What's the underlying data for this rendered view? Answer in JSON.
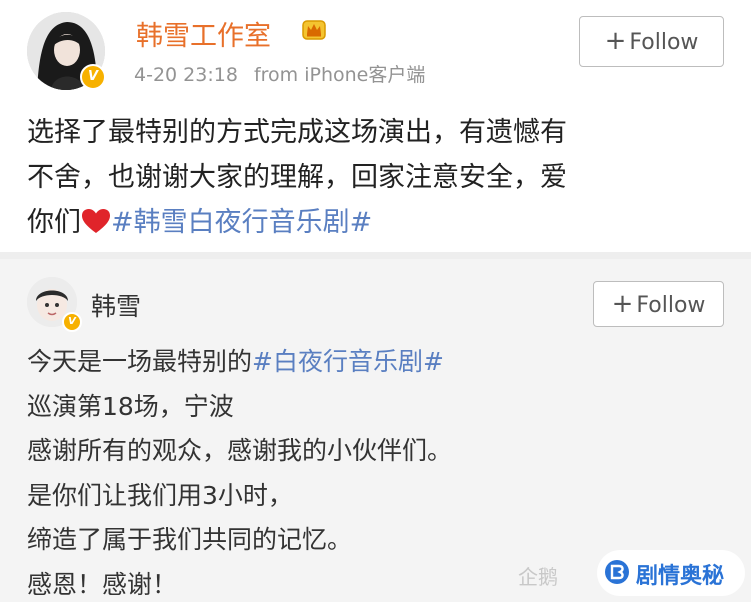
{
  "post": {
    "author": "韩雪工作室",
    "time": "4-20 23:18",
    "source": "from iPhone客户端",
    "follow_label": "Follow",
    "text_lines": [
      "选择了最特别的方式完成这场演出，有遗憾有",
      "不舍，也谢谢大家的理解，回家注意安全，爱"
    ],
    "text_last_prefix": "你们",
    "hashtag": "#韩雪白夜行音乐剧#"
  },
  "repost": {
    "author": "韩雪",
    "follow_label": "Follow",
    "line1_prefix": "今天是一场最特别的",
    "line1_hashtag": "#白夜行音乐剧#",
    "lines": [
      "巡演第18场，宁波",
      "感谢所有的观众，感谢我的小伙伴们。",
      "是你们让我们用3小时，",
      "缔造了属于我们共同的记忆。",
      "感恩！感谢！"
    ]
  },
  "watermark": {
    "left_text": "企鹅",
    "brand": "剧情奥秘"
  },
  "colors": {
    "author_orange": "#e8702a",
    "hashtag_blue": "#5a7fc1",
    "heart_red": "#e0242a",
    "badge_gold": "#f7b100"
  },
  "icons": {
    "crown": "crown-icon",
    "verified": "verified-v-icon",
    "heart": "heart-icon",
    "plus": "plus-icon"
  }
}
